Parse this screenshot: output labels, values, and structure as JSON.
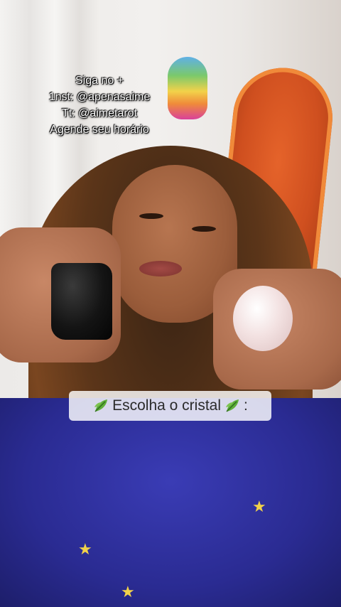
{
  "overlay": {
    "lines": [
      "Siga no +",
      "1nst: @apenasaime",
      "Tt: @aimetarot",
      "Agende seu horário"
    ]
  },
  "cta": {
    "text": "Escolha o cristal",
    "suffix": ":",
    "icon": "herb-leaf-icon"
  },
  "colors": {
    "shirt": "#2a2b92",
    "surfboard": "#cf4f1f",
    "cta_background": "#ffffff"
  }
}
